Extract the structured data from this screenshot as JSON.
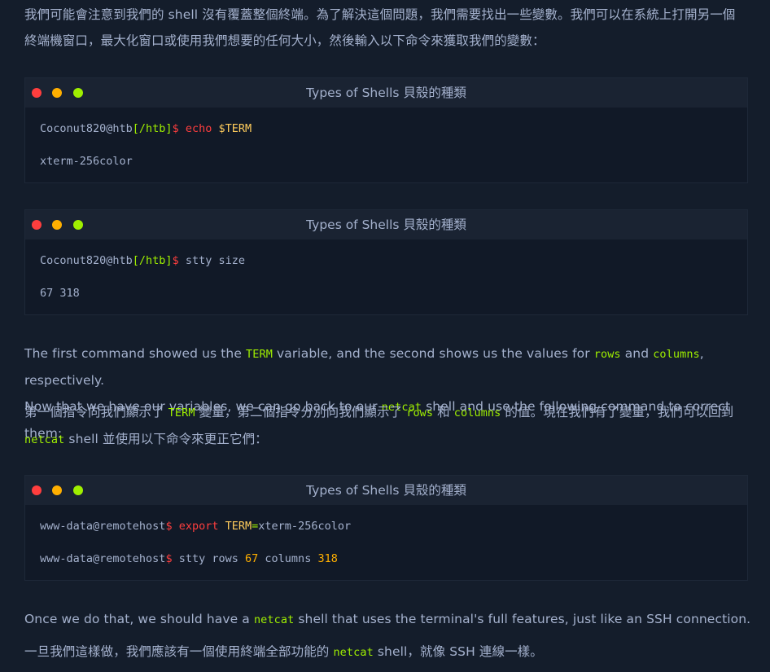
{
  "intro": {
    "line1": "我們可能會注意到我們的 shell 沒有覆蓋整個終端。為了解決這個問題，我們需要找出一些變數。我們可以在系統上打開另一個",
    "line2": "終端機窗口，最大化窗口或使用我們想要的任何大小，然後輸入以下命令來獲取我們的變數："
  },
  "windows": [
    {
      "title": "Types of Shells 貝殼的種類",
      "prompt_user": "Coconut820@htb",
      "prompt_path": "[/htb]",
      "prompt_symbol": "$",
      "command": "echo",
      "arg": "$TERM",
      "output": "xterm-256color"
    },
    {
      "title": "Types of Shells 貝殼的種類",
      "prompt_user": "Coconut820@htb",
      "prompt_path": "[/htb]",
      "prompt_symbol": "$",
      "command": "stty size",
      "output": "67 318"
    },
    {
      "title": "Types of Shells 貝殼的種類",
      "line1": {
        "prompt": "www-data@remotehost",
        "symbol": "$",
        "command": "export",
        "var": "TERM",
        "eq": "=",
        "value": "xterm-256color"
      },
      "line2": {
        "prompt": "www-data@remotehost",
        "symbol": "$",
        "cmd1": "stty rows",
        "num1": "67",
        "cmd2": "columns",
        "num2": "318"
      }
    }
  ],
  "explain_en": {
    "p1_a": "The first command showed us the ",
    "term": "TERM",
    "p1_b": " variable, and the second shows us the values for ",
    "rows": "rows",
    "and": " and ",
    "columns": "columns",
    "p1_c": ", respectively.",
    "p2_a": "Now that we have our variables, we can go back to our ",
    "netcat": "netcat",
    "p2_b": " shell and use the following command to correct them:"
  },
  "explain_zh": {
    "a": "第一個指令向我們顯示了 ",
    "term": "TERM",
    "b": " 變量，第二個指令分別向我們顯示了 ",
    "rows": "rows",
    "c": " 和 ",
    "columns": "columns",
    "d": " 的值。現在我們有了變量，我們可以回到",
    "netcat": "netcat",
    "e": " shell 並使用以下命令來更正它們："
  },
  "outro_en": {
    "a": "Once we do that, we should have a ",
    "netcat": "netcat",
    "b": " shell that uses the terminal's full features, just like an SSH connection."
  },
  "outro_zh": {
    "a": "一旦我們這樣做，我們應該有一個使用終端全部功能的 ",
    "netcat": "netcat",
    "b": " shell，就像 SSH 連線一樣。"
  }
}
